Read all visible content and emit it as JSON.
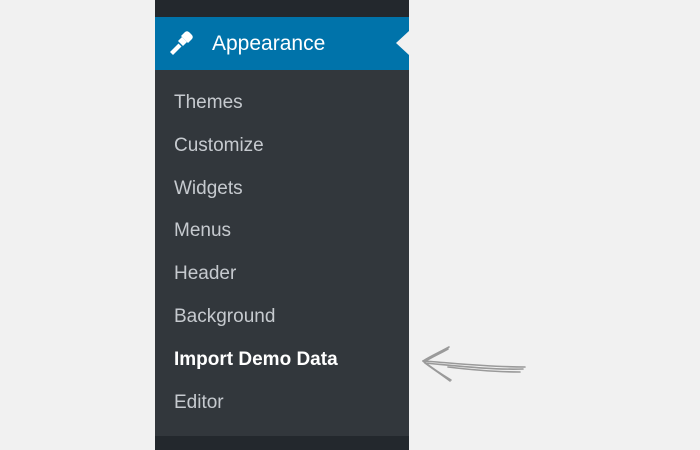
{
  "menu": {
    "parent": {
      "label": "Appearance",
      "icon": "paintbrush-icon"
    },
    "items": [
      {
        "label": "Themes"
      },
      {
        "label": "Customize"
      },
      {
        "label": "Widgets"
      },
      {
        "label": "Menus"
      },
      {
        "label": "Header"
      },
      {
        "label": "Background"
      },
      {
        "label": "Import Demo Data",
        "current": true
      },
      {
        "label": "Editor"
      }
    ]
  },
  "annotation": {
    "icon": "hand-drawn-arrow-icon"
  },
  "colors": {
    "page_background": "#f1f1f1",
    "menu_background": "#23282d",
    "submenu_background": "#32373c",
    "active_accent": "#0073aa",
    "submenu_text": "#c6cacf",
    "current_text": "#ffffff",
    "arrow_stroke": "#9a9a9a"
  }
}
